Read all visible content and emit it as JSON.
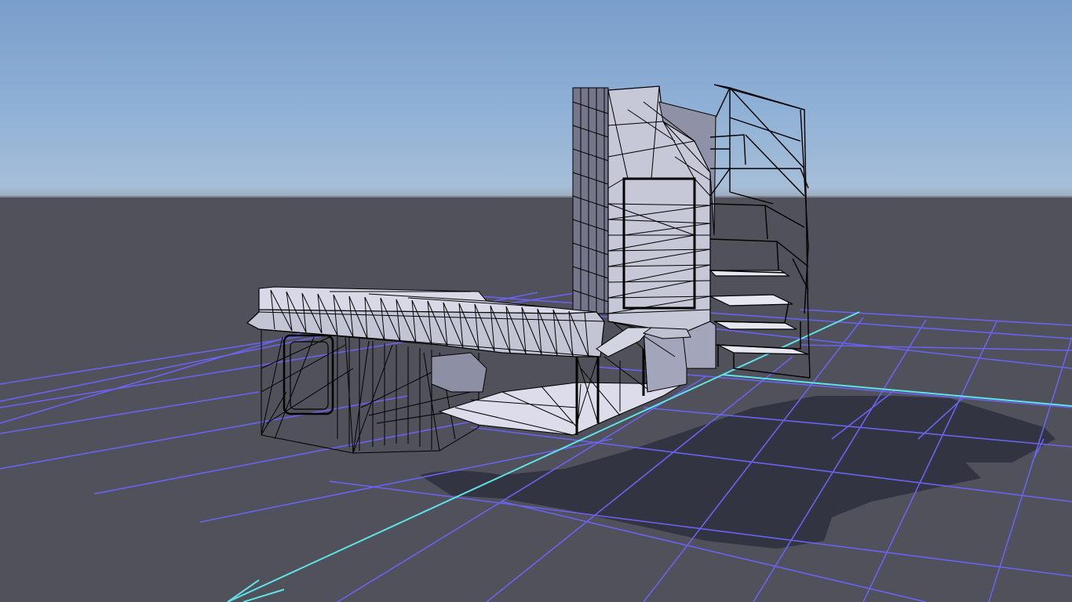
{
  "scene": {
    "type": "3d-editor-viewport",
    "view_mode": "shaded-wireframe",
    "colors": {
      "sky_top": "#7a9ecb",
      "sky_horizon": "#a9c0d8",
      "ground": "#50515a",
      "grid_line": "#6a63f0",
      "axis_line": "#5fe3e6",
      "mesh_fill": "#c5c6d6",
      "mesh_shade": "#9d9fb2",
      "mesh_dark": "#747489",
      "wire": "#000000",
      "shadow": "#2e2f3e"
    },
    "objects": [
      {
        "name": "ground-grid"
      },
      {
        "name": "origin-axis"
      },
      {
        "name": "building-mesh"
      },
      {
        "name": "staircase-wireframe"
      }
    ]
  }
}
